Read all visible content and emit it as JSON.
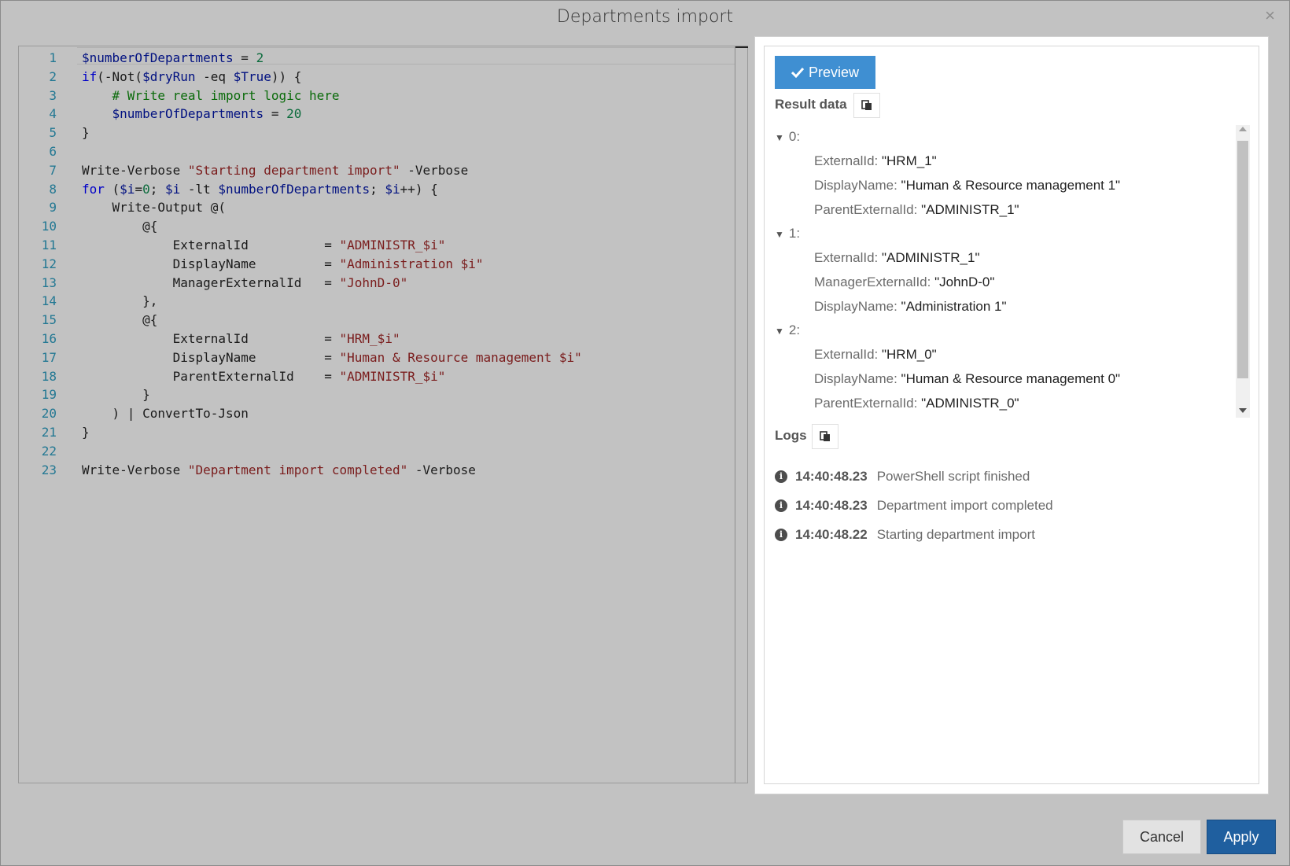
{
  "dialog": {
    "title": "Departments import",
    "close_glyph": "×"
  },
  "editor": {
    "lines": [
      {
        "n": "1",
        "t": [
          [
            "v",
            "$numberOfDepartments"
          ],
          [
            "txt",
            " = "
          ],
          [
            "num",
            "2"
          ]
        ]
      },
      {
        "n": "2",
        "t": [
          [
            "kw",
            "if"
          ],
          [
            "txt",
            "(-Not("
          ],
          [
            "v",
            "$dryRun"
          ],
          [
            "txt",
            " -eq "
          ],
          [
            "v",
            "$True"
          ],
          [
            "txt",
            ")) {"
          ]
        ]
      },
      {
        "n": "3",
        "t": [
          [
            "txt",
            "    "
          ],
          [
            "cm",
            "# Write real import logic here"
          ]
        ]
      },
      {
        "n": "4",
        "t": [
          [
            "txt",
            "    "
          ],
          [
            "v",
            "$numberOfDepartments"
          ],
          [
            "txt",
            " = "
          ],
          [
            "num",
            "20"
          ]
        ]
      },
      {
        "n": "5",
        "t": [
          [
            "txt",
            "}"
          ]
        ]
      },
      {
        "n": "6",
        "t": []
      },
      {
        "n": "7",
        "t": [
          [
            "txt",
            "Write-Verbose "
          ],
          [
            "str",
            "\"Starting department import\""
          ],
          [
            "txt",
            " -Verbose"
          ]
        ]
      },
      {
        "n": "8",
        "t": [
          [
            "kw",
            "for"
          ],
          [
            "txt",
            " ("
          ],
          [
            "v",
            "$i"
          ],
          [
            "txt",
            "="
          ],
          [
            "num",
            "0"
          ],
          [
            "txt",
            "; "
          ],
          [
            "v",
            "$i"
          ],
          [
            "txt",
            " -lt "
          ],
          [
            "v",
            "$numberOfDepartments"
          ],
          [
            "txt",
            "; "
          ],
          [
            "v",
            "$i"
          ],
          [
            "txt",
            "++) {"
          ]
        ]
      },
      {
        "n": "9",
        "t": [
          [
            "txt",
            "    Write-Output @("
          ]
        ]
      },
      {
        "n": "10",
        "t": [
          [
            "txt",
            "        @{"
          ]
        ]
      },
      {
        "n": "11",
        "t": [
          [
            "txt",
            "            ExternalId          = "
          ],
          [
            "str",
            "\"ADMINISTR_$i\""
          ]
        ]
      },
      {
        "n": "12",
        "t": [
          [
            "txt",
            "            DisplayName         = "
          ],
          [
            "str",
            "\"Administration $i\""
          ]
        ]
      },
      {
        "n": "13",
        "t": [
          [
            "txt",
            "            ManagerExternalId   = "
          ],
          [
            "str",
            "\"JohnD-0\""
          ]
        ]
      },
      {
        "n": "14",
        "t": [
          [
            "txt",
            "        },"
          ]
        ]
      },
      {
        "n": "15",
        "t": [
          [
            "txt",
            "        @{"
          ]
        ]
      },
      {
        "n": "16",
        "t": [
          [
            "txt",
            "            ExternalId          = "
          ],
          [
            "str",
            "\"HRM_$i\""
          ]
        ]
      },
      {
        "n": "17",
        "t": [
          [
            "txt",
            "            DisplayName         = "
          ],
          [
            "str",
            "\"Human & Resource management $i\""
          ]
        ]
      },
      {
        "n": "18",
        "t": [
          [
            "txt",
            "            ParentExternalId    = "
          ],
          [
            "str",
            "\"ADMINISTR_$i\""
          ]
        ]
      },
      {
        "n": "19",
        "t": [
          [
            "txt",
            "        }"
          ]
        ]
      },
      {
        "n": "20",
        "t": [
          [
            "txt",
            "    ) | ConvertTo-Json"
          ]
        ]
      },
      {
        "n": "21",
        "t": [
          [
            "txt",
            "}"
          ]
        ]
      },
      {
        "n": "22",
        "t": []
      },
      {
        "n": "23",
        "t": [
          [
            "txt",
            "Write-Verbose "
          ],
          [
            "str",
            "\"Department import completed\""
          ],
          [
            "txt",
            " -Verbose"
          ]
        ]
      }
    ]
  },
  "panel": {
    "preview_label": "Preview",
    "result_label": "Result data",
    "logs_label": "Logs",
    "result_items": [
      {
        "index": "0:",
        "fields": [
          [
            "ExternalId: ",
            "\"HRM_1\""
          ],
          [
            "DisplayName: ",
            "\"Human & Resource management 1\""
          ],
          [
            "ParentExternalId: ",
            "\"ADMINISTR_1\""
          ]
        ]
      },
      {
        "index": "1:",
        "fields": [
          [
            "ExternalId: ",
            "\"ADMINISTR_1\""
          ],
          [
            "ManagerExternalId: ",
            "\"JohnD-0\""
          ],
          [
            "DisplayName: ",
            "\"Administration 1\""
          ]
        ]
      },
      {
        "index": "2:",
        "fields": [
          [
            "ExternalId: ",
            "\"HRM_0\""
          ],
          [
            "DisplayName: ",
            "\"Human & Resource management 0\""
          ],
          [
            "ParentExternalId: ",
            "\"ADMINISTR_0\""
          ]
        ]
      }
    ],
    "logs": [
      {
        "time": "14:40:48.23",
        "message": "PowerShell script finished"
      },
      {
        "time": "14:40:48.23",
        "message": "Department import completed"
      },
      {
        "time": "14:40:48.22",
        "message": "Starting department import"
      }
    ]
  },
  "footer": {
    "cancel_label": "Cancel",
    "apply_label": "Apply"
  },
  "colors": {
    "preview": "#3f8fd2",
    "apply": "#1f5f9f",
    "backdrop": "#c2c2c2"
  }
}
